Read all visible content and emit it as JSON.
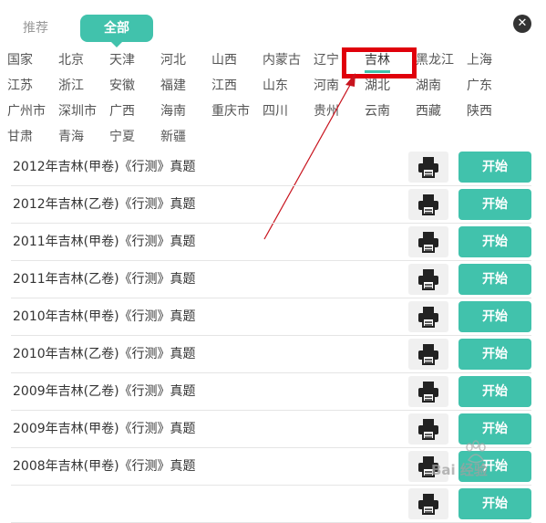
{
  "tabs": {
    "recommend": "推荐",
    "all": "全部"
  },
  "close": {
    "glyph": "✕"
  },
  "regions": {
    "items": [
      "国家",
      "北京",
      "天津",
      "河北",
      "山西",
      "内蒙古",
      "辽宁",
      "吉林",
      "黑龙江",
      "上海",
      "江苏",
      "浙江",
      "安徽",
      "福建",
      "江西",
      "山东",
      "河南",
      "湖北",
      "湖南",
      "广东",
      "广州市",
      "深圳市",
      "广西",
      "海南",
      "重庆市",
      "四川",
      "贵州",
      "云南",
      "西藏",
      "陕西",
      "甘肃",
      "青海",
      "宁夏",
      "新疆"
    ],
    "selected": "吉林"
  },
  "papers": [
    {
      "title": "2012年吉林(甲卷)《行测》真题",
      "action": "开始"
    },
    {
      "title": "2012年吉林(乙卷)《行测》真题",
      "action": "开始"
    },
    {
      "title": "2011年吉林(甲卷)《行测》真题",
      "action": "开始"
    },
    {
      "title": "2011年吉林(乙卷)《行测》真题",
      "action": "开始"
    },
    {
      "title": "2010年吉林(甲卷)《行测》真题",
      "action": "开始"
    },
    {
      "title": "2010年吉林(乙卷)《行测》真题",
      "action": "开始"
    },
    {
      "title": "2009年吉林(乙卷)《行测》真题",
      "action": "开始"
    },
    {
      "title": "2009年吉林(甲卷)《行测》真题",
      "action": "开始"
    },
    {
      "title": "2008年吉林(甲卷)《行测》真题",
      "action": "开始"
    },
    {
      "title": "",
      "action": "开始"
    }
  ],
  "icons": {
    "print": "printer-icon",
    "close": "close-icon"
  },
  "colors": {
    "accent": "#41c2ac",
    "highlight": "#e0000b",
    "arrow": "#c8141e"
  },
  "watermark": {
    "text": "Bai 经验"
  }
}
